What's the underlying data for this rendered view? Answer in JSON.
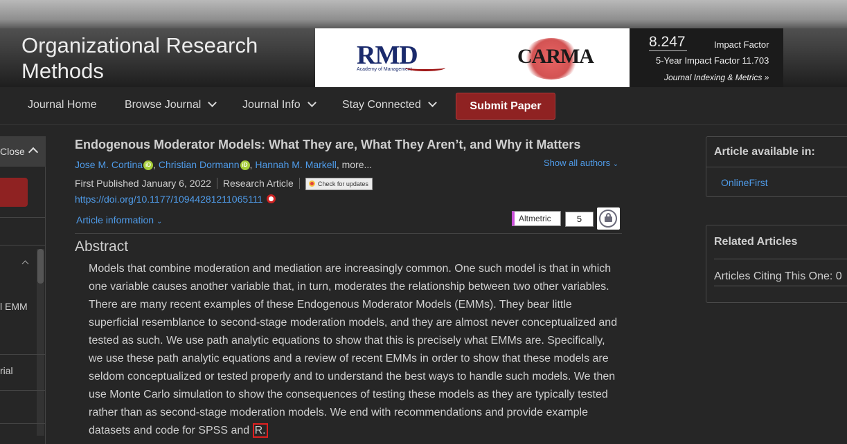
{
  "header": {
    "journal_title": "Organizational Research Methods",
    "banner": {
      "rmd_logo": "RMD",
      "rmd_sub": "Academy of Management",
      "carma_logo": "CARMA"
    },
    "metrics": {
      "impact_factor": "8.247",
      "impact_factor_label": "Impact Factor",
      "five_year": "5-Year Impact Factor 11.703",
      "indexing_link": "Journal Indexing & Metrics »"
    }
  },
  "nav": {
    "items": [
      {
        "label": "Journal Home"
      },
      {
        "label": "Browse Journal"
      },
      {
        "label": "Journal Info"
      },
      {
        "label": "Stay Connected"
      }
    ],
    "submit_label": "Submit Paper"
  },
  "sidebar": {
    "close_label": "Close",
    "items": [
      "l EMM",
      "rial"
    ]
  },
  "article": {
    "title": "Endogenous Moderator Models: What They are, What They Aren’t, and Why it Matters",
    "authors": [
      "Jose M. Cortina",
      "Christian Dormann",
      "Hannah M. Markell"
    ],
    "more": "more...",
    "show_all": "Show all authors",
    "published": "First Published January 6, 2022",
    "type": "Research Article",
    "check_updates": "Check for updates",
    "doi": "https://doi.org/10.1177/10944281211065111",
    "article_info": "Article information",
    "altmetric_label": "Altmetric",
    "altmetric_count": "5",
    "abstract_heading": "Abstract",
    "abstract_text": "Models that combine moderation and mediation are increasingly common. One such model is that in which one variable causes another variable that, in turn, moderates the relationship between two other variables. There are many recent examples of these Endogenous Moderator Models (EMMs). They bear little superficial resemblance to second-stage moderation models, and they are almost never conceptualized and tested as such. We use path analytic equations to show that this is precisely what EMMs are. Specifically, we use these path analytic equations and a review of recent EMMs in order to show that these models are seldom conceptualized or tested properly and to understand the best ways to handle such models. We then use Monte Carlo simulation to show the consequences of testing these models as they are typically tested rather than as second-stage moderation models. We end with recommendations and provide example datasets and code for SPSS and",
    "abstract_end": "R."
  },
  "right": {
    "available_heading": "Article available in:",
    "available_link": "OnlineFirst",
    "related_heading": "Related Articles",
    "citing": "Articles Citing This One: 0"
  },
  "colors": {
    "accent_red": "#8f2222",
    "link_blue": "#4f9be8",
    "background": "#262626"
  }
}
